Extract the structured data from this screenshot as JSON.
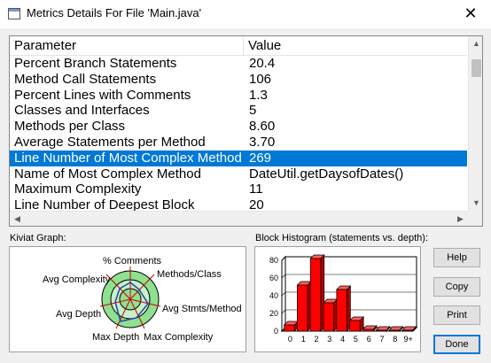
{
  "window": {
    "title": "Metrics Details For File 'Main.java'",
    "close_glyph": "✕"
  },
  "table": {
    "columns": [
      "Parameter",
      "Value"
    ],
    "rows": [
      {
        "param": "Percent Branch Statements",
        "value": "20.4"
      },
      {
        "param": "Method Call Statements",
        "value": "106"
      },
      {
        "param": "Percent Lines with Comments",
        "value": "1.3"
      },
      {
        "param": "Classes and Interfaces",
        "value": "5"
      },
      {
        "param": "Methods per Class",
        "value": "8.60"
      },
      {
        "param": "Average Statements per Method",
        "value": "3.70"
      },
      {
        "param": "Line Number of Most Complex Method",
        "value": "269",
        "selected": true
      },
      {
        "param": "Name of Most Complex Method",
        "value": "DateUtil.getDaysofDates()"
      },
      {
        "param": "Maximum Complexity",
        "value": "11"
      },
      {
        "param": "Line Number of Deepest Block",
        "value": "20"
      }
    ],
    "selected_color": "#0078d7"
  },
  "kiviat": {
    "label": "Kiviat Graph:",
    "axes": [
      "% Comments",
      "Methods/Class",
      "Avg Stmts/Method",
      "Max Complexity",
      "Max Depth",
      "Avg Depth",
      "Avg Complexity"
    ],
    "colors": {
      "ring_outer": "#8fe08f",
      "ring_inner": "#c8f0c8",
      "polygon": "#2244aa",
      "axis": "#cc0000"
    }
  },
  "histogram": {
    "label": "Block Histogram (statements vs. depth):",
    "bar_color": "#ff0000"
  },
  "chart_data": {
    "type": "bar",
    "categories": [
      "0",
      "1",
      "2",
      "3",
      "4",
      "5",
      "6",
      "7",
      "8",
      "9+"
    ],
    "values": [
      7,
      52,
      82,
      32,
      47,
      12,
      2,
      1,
      1,
      1
    ],
    "ylim": [
      0,
      80
    ],
    "yticks": [
      "80",
      "60",
      "40",
      "20",
      "0"
    ],
    "title": "Block Histogram (statements vs. depth):",
    "xlabel": "",
    "ylabel": "",
    "grid": true
  },
  "buttons": {
    "help": "Help",
    "copy": "Copy",
    "print": "Print",
    "done": "Done"
  }
}
